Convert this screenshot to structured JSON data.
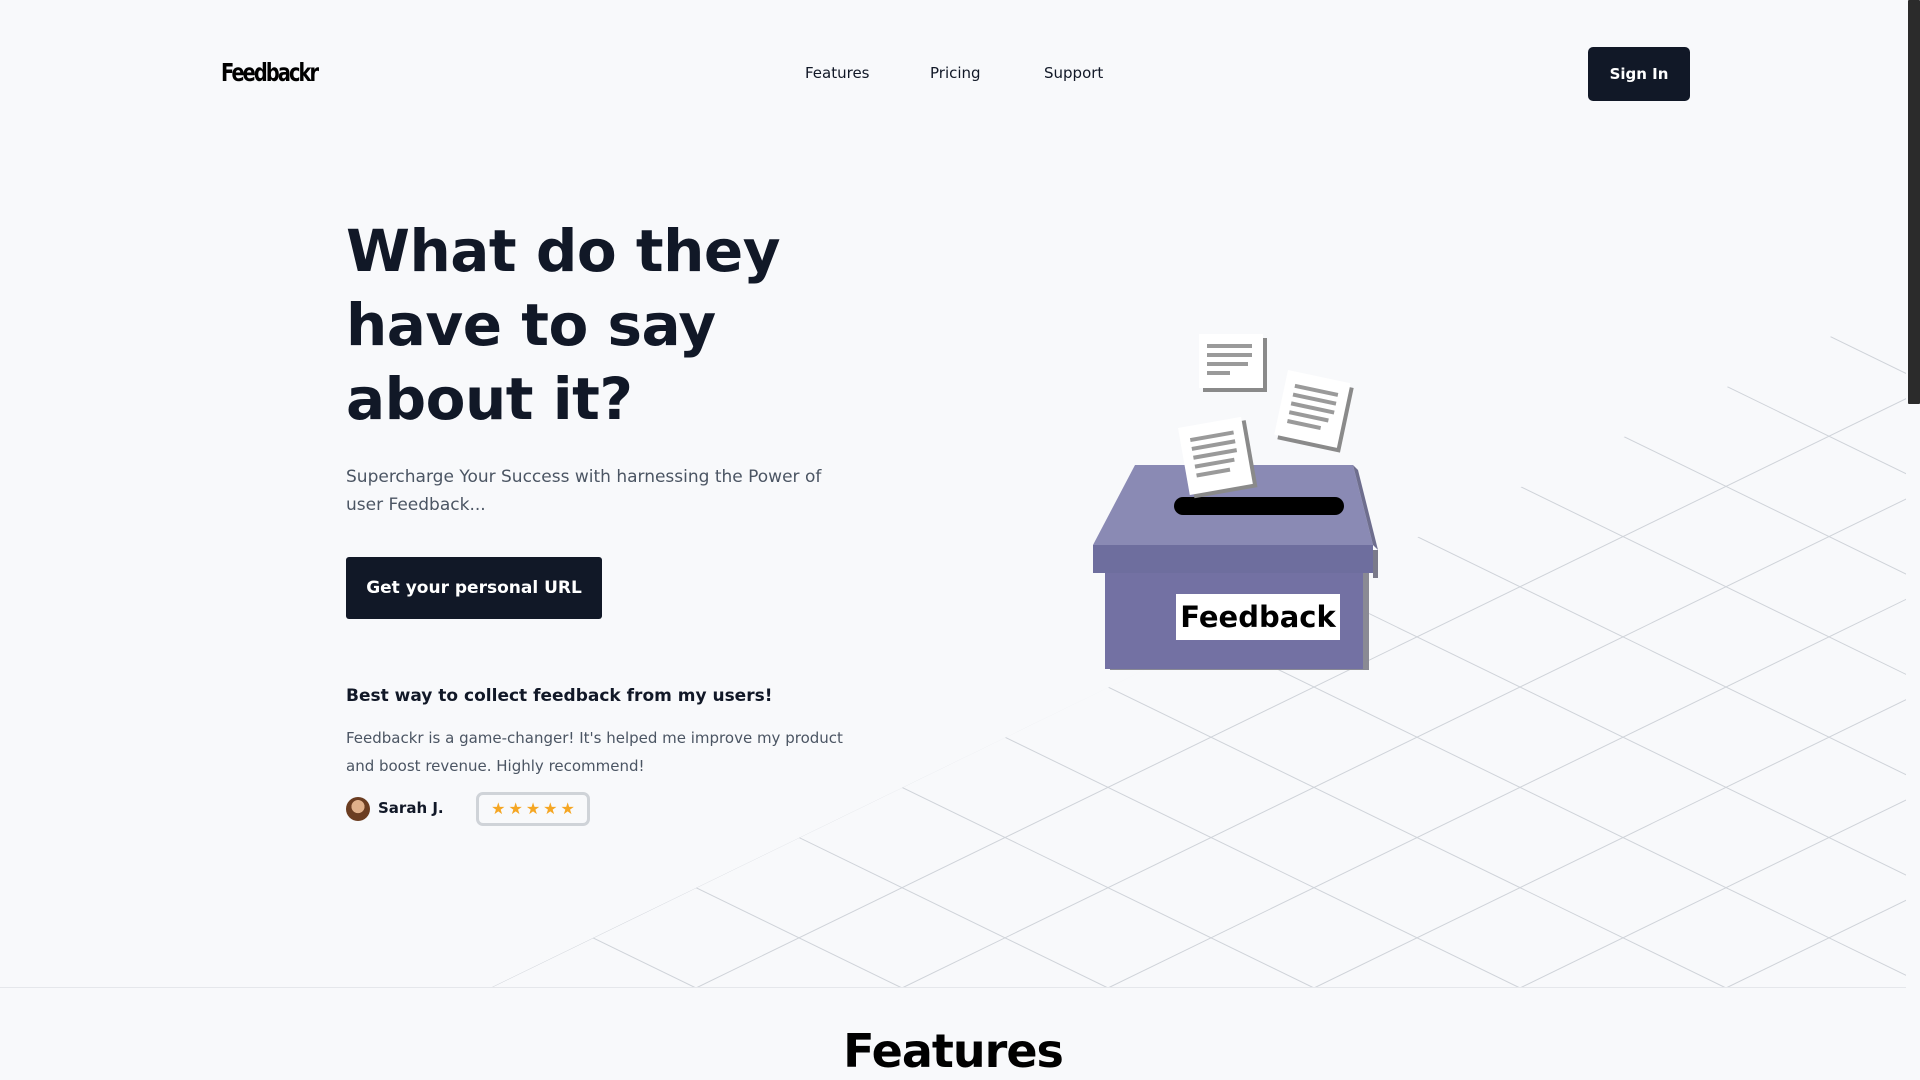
{
  "header": {
    "logo": "Feedbackr",
    "nav": [
      {
        "label": "Features"
      },
      {
        "label": "Pricing"
      },
      {
        "label": "Support"
      }
    ],
    "signin_label": "Sign In"
  },
  "hero": {
    "title": "What do they have to say about it?",
    "subtitle": "Supercharge Your Success with harnessing the Power of user Feedback...",
    "cta_label": "Get your personal URL",
    "illustration_label": "Feedback"
  },
  "testimonial": {
    "heading": "Best way to collect feedback from my users!",
    "body": "Feedbackr is a game-changer! It's helped me improve my product and boost revenue. Highly recommend!",
    "author": "Sarah J.",
    "rating": 5,
    "star_glyph": "★"
  },
  "features": {
    "title": "Features"
  },
  "colors": {
    "primary": "#111827",
    "background": "#f8f9fb",
    "box": "#7371a3",
    "star": "#f5a623"
  }
}
